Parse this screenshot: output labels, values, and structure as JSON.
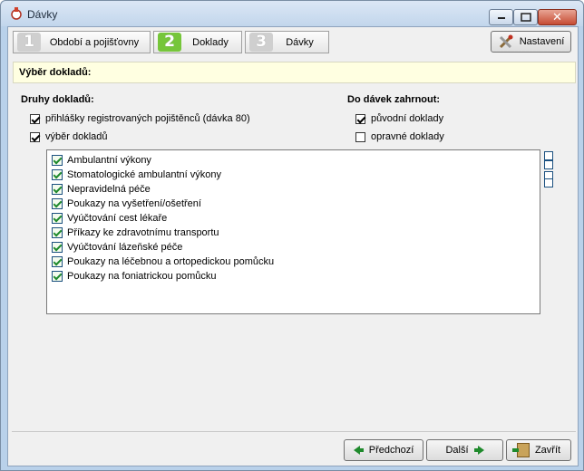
{
  "window": {
    "title": "Dávky"
  },
  "steps": [
    {
      "num": "1",
      "label": "Období a pojišťovny"
    },
    {
      "num": "2",
      "label": "Doklady"
    },
    {
      "num": "3",
      "label": "Dávky"
    }
  ],
  "toolbar": {
    "settings_label": "Nastavení",
    "settings_icon": "tools-icon"
  },
  "section": {
    "title": "Výběr dokladů:"
  },
  "druhy": {
    "title": "Druhy dokladů:",
    "options": [
      {
        "label": "přihlášky registrovaných pojištěnců (dávka 80)",
        "checked": true
      },
      {
        "label": "výběr dokladů",
        "checked": true
      }
    ]
  },
  "davky": {
    "title": "Do dávek zahrnout:",
    "options": [
      {
        "label": "původní doklady",
        "checked": true
      },
      {
        "label": "opravné doklady",
        "checked": false
      }
    ]
  },
  "list": {
    "items": [
      "Ambulantní výkony",
      "Stomatologické ambulantní výkony",
      "Nepravidelná péče",
      "Poukazy na vyšetření/ošetření",
      "Vyúčtování cest lékaře",
      "Příkazy ke zdravotnímu transportu",
      "Vyúčtování lázeňské péče",
      "Poukazy na léčebnou a ortopedickou pomůcku",
      "Poukazy na foniatrickou pomůcku"
    ]
  },
  "footer": {
    "prev_label": "Předchozí",
    "next_label": "Další",
    "close_label": "Zavřít"
  }
}
